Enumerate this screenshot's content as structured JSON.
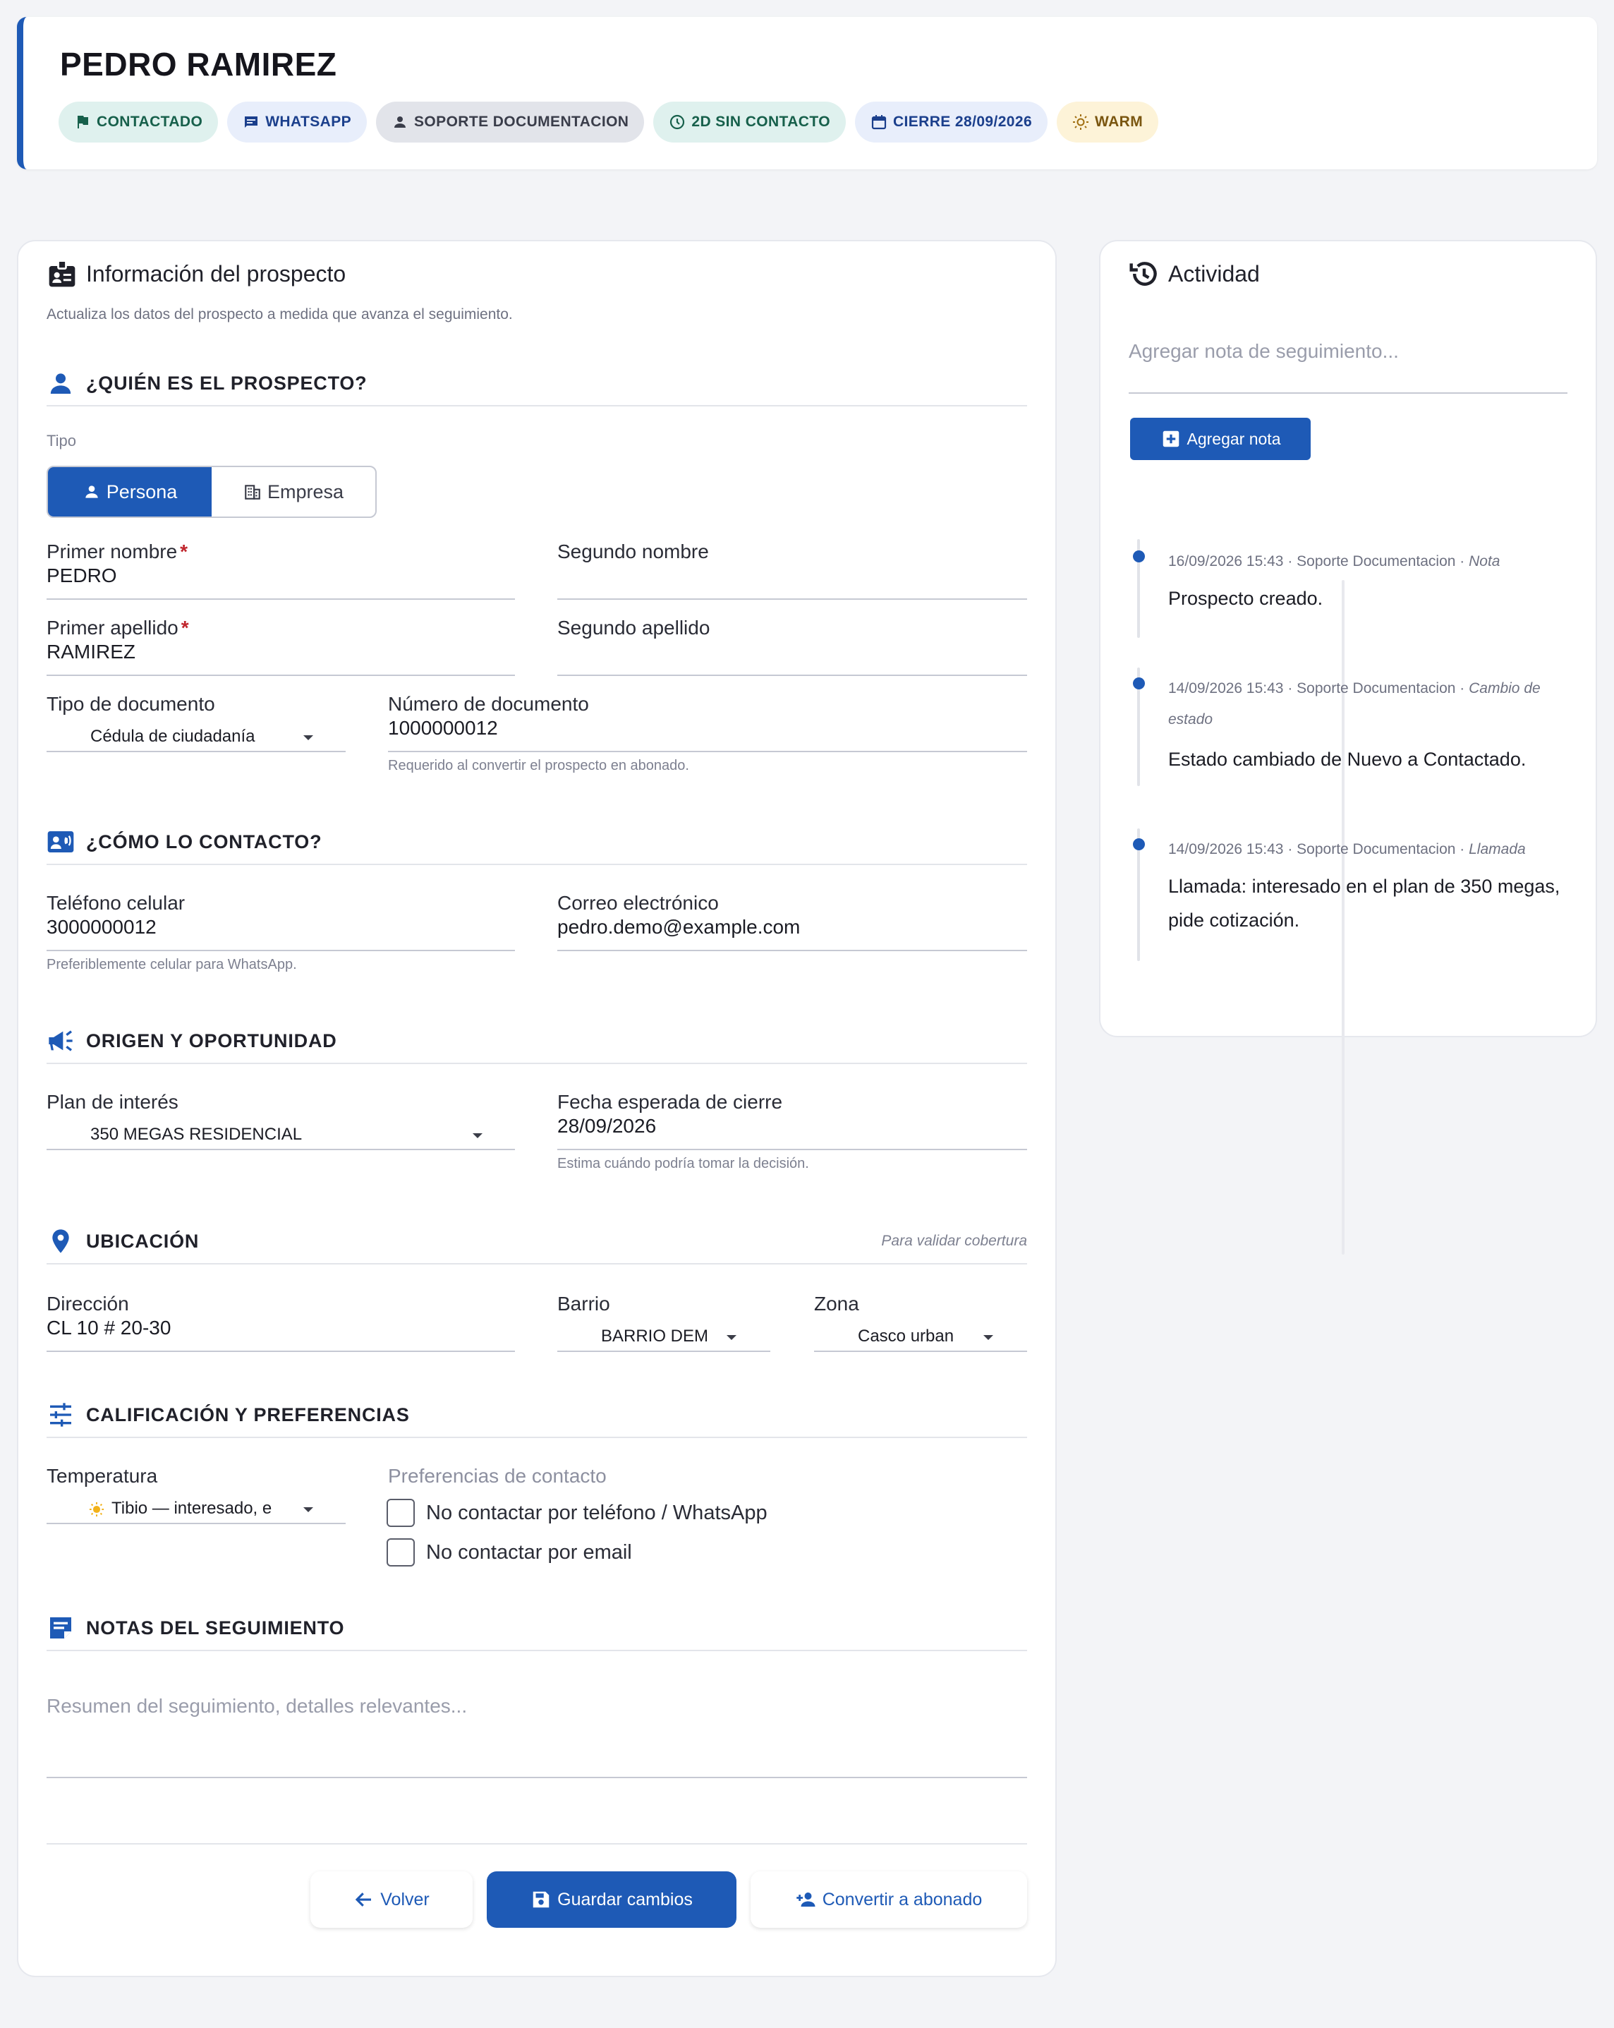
{
  "header": {
    "title": "PEDRO RAMIREZ",
    "chips": {
      "status": "CONTACTADO",
      "channel": "WHATSAPP",
      "owner": "SOPORTE DOCUMENTACION",
      "days": "2D SIN CONTACTO",
      "close": "CIERRE 28/09/2026",
      "temp": "WARM"
    }
  },
  "form": {
    "title": "Información del prospecto",
    "subtitle": "Actualiza los datos del prospecto a medida que avanza el seguimiento.",
    "who": {
      "heading": "¿QUIÉN ES EL PROSPECTO?",
      "tipo_label": "Tipo",
      "persona": "Persona",
      "empresa": "Empresa",
      "primer_nombre_label": "Primer nombre",
      "primer_nombre": "PEDRO",
      "segundo_nombre_label": "Segundo nombre",
      "segundo_nombre": "",
      "primer_apellido_label": "Primer apellido",
      "primer_apellido": "RAMIREZ",
      "segundo_apellido_label": "Segundo apellido",
      "segundo_apellido": "",
      "tipo_doc_label": "Tipo de documento",
      "tipo_doc": "Cédula de ciudadanía",
      "num_doc_label": "Número de documento",
      "num_doc": "1000000012",
      "num_doc_help": "Requerido al convertir el prospecto en abonado.",
      "required_mark": "*"
    },
    "contact": {
      "heading": "¿CÓMO LO CONTACTO?",
      "phone_label": "Teléfono celular",
      "phone": "3000000012",
      "phone_help": "Preferiblemente celular para WhatsApp.",
      "email_label": "Correo electrónico",
      "email": "pedro.demo@example.com"
    },
    "origin": {
      "heading": "ORIGEN Y OPORTUNIDAD",
      "plan_label": "Plan de interés",
      "plan": "350 MEGAS RESIDENCIAL",
      "close_label": "Fecha esperada de cierre",
      "close": "28/09/2026",
      "close_help": "Estima cuándo podría tomar la decisión."
    },
    "location": {
      "heading": "UBICACIÓN",
      "hint": "Para validar cobertura",
      "address_label": "Dirección",
      "address": "CL 10 # 20-30",
      "barrio_label": "Barrio",
      "barrio": "BARRIO DEM",
      "zona_label": "Zona",
      "zona": "Casco urban"
    },
    "qualify": {
      "heading": "CALIFICACIÓN Y PREFERENCIAS",
      "temp_label": "Temperatura",
      "temp": "Tibio — interesado, e",
      "prefs_label": "Preferencias de contacto",
      "pref_phone": "No contactar por teléfono / WhatsApp",
      "pref_email": "No contactar por email"
    },
    "notes": {
      "heading": "NOTAS DEL SEGUIMIENTO",
      "placeholder": "Resumen del seguimiento, detalles relevantes..."
    },
    "buttons": {
      "back": "Volver",
      "save": "Guardar cambios",
      "convert": "Convertir a abonado"
    }
  },
  "activity": {
    "title": "Actividad",
    "note_placeholder": "Agregar nota de seguimiento...",
    "add_note": "Agregar nota",
    "events": [
      {
        "meta": "16/09/2026 15:43 · Soporte Documentacion · ",
        "type": "Nota",
        "text": "Prospecto creado."
      },
      {
        "meta": "14/09/2026 15:43 · Soporte Documentacion · ",
        "type": "Cambio de estado",
        "text": "Estado cambiado de Nuevo a Contactado."
      },
      {
        "meta": "14/09/2026 15:43 · Soporte Documentacion · ",
        "type": "Llamada",
        "text": "Llamada: interesado en el plan de 350 megas, pide cotización."
      }
    ]
  },
  "colors": {
    "accent": "#1e5ab6",
    "chip_green": "#dff1ee",
    "chip_blue": "#e8eefb",
    "chip_gray": "#e2e4ea",
    "chip_warm": "#fdf3d8",
    "required": "#c0262d"
  },
  "icons": {
    "status": "flag-icon",
    "channel": "message-icon",
    "owner": "person-icon",
    "days": "clock-icon",
    "close": "calendar-icon",
    "temp": "sun-icon",
    "form_title": "badge-icon",
    "activity": "history-icon"
  }
}
